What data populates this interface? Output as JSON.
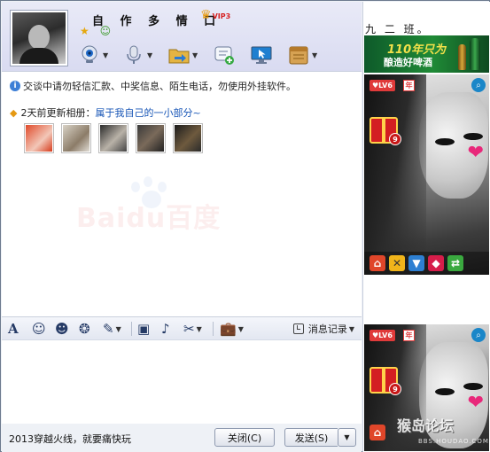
{
  "window": {
    "controls": [
      "minimize",
      "restore",
      "close"
    ]
  },
  "header": {
    "nickname": "自 作 多 情 口",
    "vip_label": "VIP3",
    "toolbar_buttons": [
      {
        "name": "video-call",
        "icon": "webcam-icon"
      },
      {
        "name": "voice-call",
        "icon": "microphone-icon"
      },
      {
        "name": "send-file",
        "icon": "folder-arrow-icon"
      },
      {
        "name": "create-discussion",
        "icon": "chat-list-plus-icon"
      },
      {
        "name": "remote-assist",
        "icon": "monitor-cursor-icon"
      },
      {
        "name": "apps",
        "icon": "app-box-icon"
      }
    ]
  },
  "chat": {
    "notice": "交谈中请勿轻信汇款、中奖信息、陌生电话，勿使用外挂软件。",
    "album_prefix": "2天前更新相册：",
    "album_title": "属于我自己的一小部分~",
    "thumb_colors": [
      "#d9472b",
      "#9b8c7a",
      "#5c5148",
      "#3b3b3b",
      "#2f2a26"
    ],
    "watermark": "Baidu百度"
  },
  "input_toolbar": {
    "history_label": "消息记录"
  },
  "bottom": {
    "signature_text": "2013穿越火线，就要痛快玩",
    "close_label": "关闭(C)",
    "send_label": "发送(S)"
  },
  "right_panel": {
    "friend_signature": "九 二 班。",
    "ad_line1": "110年只为",
    "ad_line2": "酿造好啤酒",
    "show_level": "LV6",
    "year_badge": "年",
    "gift_count": "9",
    "watermark_main": "猴岛论坛",
    "watermark_sub": "BBS.HOUDAO.COM"
  },
  "colors": {
    "accent_blue": "#1755b6",
    "header_bg": "#e9eaf7",
    "gift_red": "#d31e22"
  }
}
